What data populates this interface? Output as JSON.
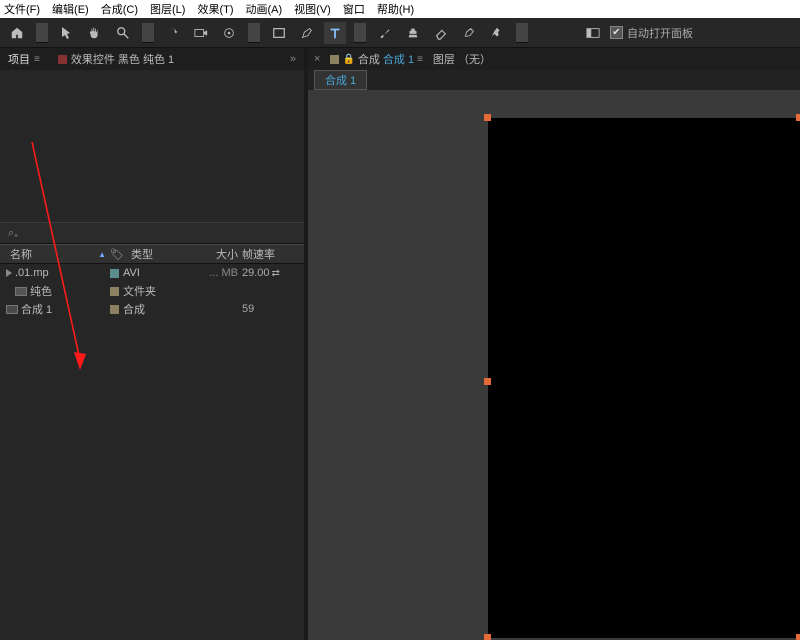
{
  "menu": {
    "file": "文件(F)",
    "edit": "编辑(E)",
    "comp": "合成(C)",
    "layer": "图层(L)",
    "effect": "效果(T)",
    "anim": "动画(A)",
    "view": "视图(V)",
    "window": "窗口",
    "help": "帮助(H)"
  },
  "toolbar": {
    "auto_open_label": "自动打开面板"
  },
  "project_panel": {
    "tab_project": "项目",
    "tab_effect_controls": "效果控件 黑色 纯色 1",
    "search_placeholder": "",
    "columns": {
      "name": "名称",
      "type": "类型",
      "size": "大小",
      "fps": "帧速率"
    },
    "rows": [
      {
        "name": ".01.mp",
        "type": "AVI",
        "size": "... MB",
        "fps": "29.00"
      },
      {
        "name": "纯色",
        "type": "文件夹",
        "size": "",
        "fps": ""
      },
      {
        "name": "合成 1",
        "type": "合成",
        "size": "",
        "fps": "59"
      }
    ]
  },
  "composition_panel": {
    "tab_comp_prefix": "合成",
    "tab_comp_name": "合成 1",
    "tab_layer": "图层 （无）",
    "sub_tab": "合成 1"
  },
  "accent": "#4aa6d6"
}
